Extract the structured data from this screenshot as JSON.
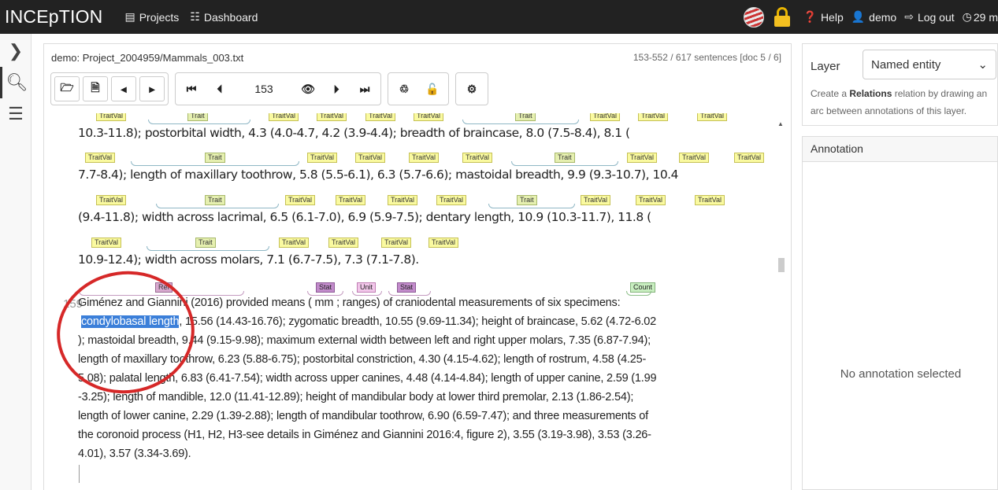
{
  "navbar": {
    "brand": "INCEpTION",
    "projects": "Projects",
    "dashboard": "Dashboard",
    "help": "Help",
    "user": "demo",
    "logout": "Log out",
    "timer": "29 m"
  },
  "document": {
    "path": "demo: Project_2004959/Mammals_003.txt",
    "sentence_info": "153-552 / 617 sentences [doc 5 / 6]"
  },
  "toolbar": {
    "sentence_value": "153",
    "icons": [
      "folder-open-icon",
      "export-icon",
      "prev-doc-icon",
      "next-doc-icon",
      "first-page-icon",
      "prev-page-icon",
      "eye-icon",
      "next-page-icon",
      "last-page-icon",
      "recycle-icon",
      "unlock-icon",
      "settings-icon"
    ]
  },
  "sentence1": {
    "lines": [
      "10.3-11.8); postorbital width,    4.3   (4.0-4.7,  4.2   (3.9-4.4); breadth of braincase,   8.0   (7.5-8.4),    8.1   (",
      "7.7-8.4); length of maxillary toothrow,  5.8   (5.5-6.1),  6.3    (5.7-6.6); mastoidal breadth,  9.9   (9.3-10.7),  10.4",
      " (9.4-11.8);  width across lacrimal,  6.5   (6.1-7.0),  6.9   (5.9-7.5); dentary length,  10.9  (10.3-11.7),  11.8   (",
      "10.9-12.4); width across molars,    7.1   (6.7-7.5),   7.3   (7.1-7.8)."
    ]
  },
  "sentence2": {
    "number": "159",
    "line1_a": "Giménez and Giannini (2016)",
    "line1_b": "  provided means ( mm ; ranges) of craniodental measurements  of  six   specimens:",
    "line2_hl": "condylobasal length",
    "line2_rest": ", 15.56 (14.43-16.76);  zygomatic breadth, 10.55 (9.69-11.34); height of braincase,  5.62 (4.72-6.02",
    "lines": [
      "); mastoidal breadth, 9.44 (9.15-9.98); maximum   external width between left and right upper molars, 7.35  (6.87-7.94);",
      "length of maxillary toothrow, 6.23 (5.88-6.75);  postorbital constriction, 4.30 (4.15-4.62); length of rostrum,  4.58 (4.25-",
      "5.08); palatal length, 6.83 (6.41-7.54); width across  upper canines, 4.48 (4.14-4.84); length of upper canine, 2.59  (1.99",
      "-3.25); length of mandible, 12.0 (11.41-12.89); height  of mandibular body at lower third premolar, 2.13 (1.86-2.54);",
      "  length of lower canine, 2.29 (1.39-2.88); length of mandibular  toothrow, 6.90 (6.59-7.47); and three measurements of",
      " the coronoid  process (H1, H2, H3-see details in Giménez and Giannini  2016:4, figure 2), 3.55 (3.19-3.98), 3.53 (3.26-",
      "4.01), 3.57  (3.34-3.69)."
    ]
  },
  "labels": {
    "trait": "Trait",
    "traitval": "TraitVal",
    "ref": "Ref",
    "stat": "Stat",
    "unit": "Unit",
    "count": "Count"
  },
  "right_panel": {
    "layer_label": "Layer",
    "layer_value": "Named entity",
    "help_prefix": "Create a ",
    "help_bold": "Relations",
    "help_suffix": " relation by drawing an arc between annotations of this layer.",
    "annotation_title": "Annotation",
    "annotation_empty": "No annotation selected"
  }
}
